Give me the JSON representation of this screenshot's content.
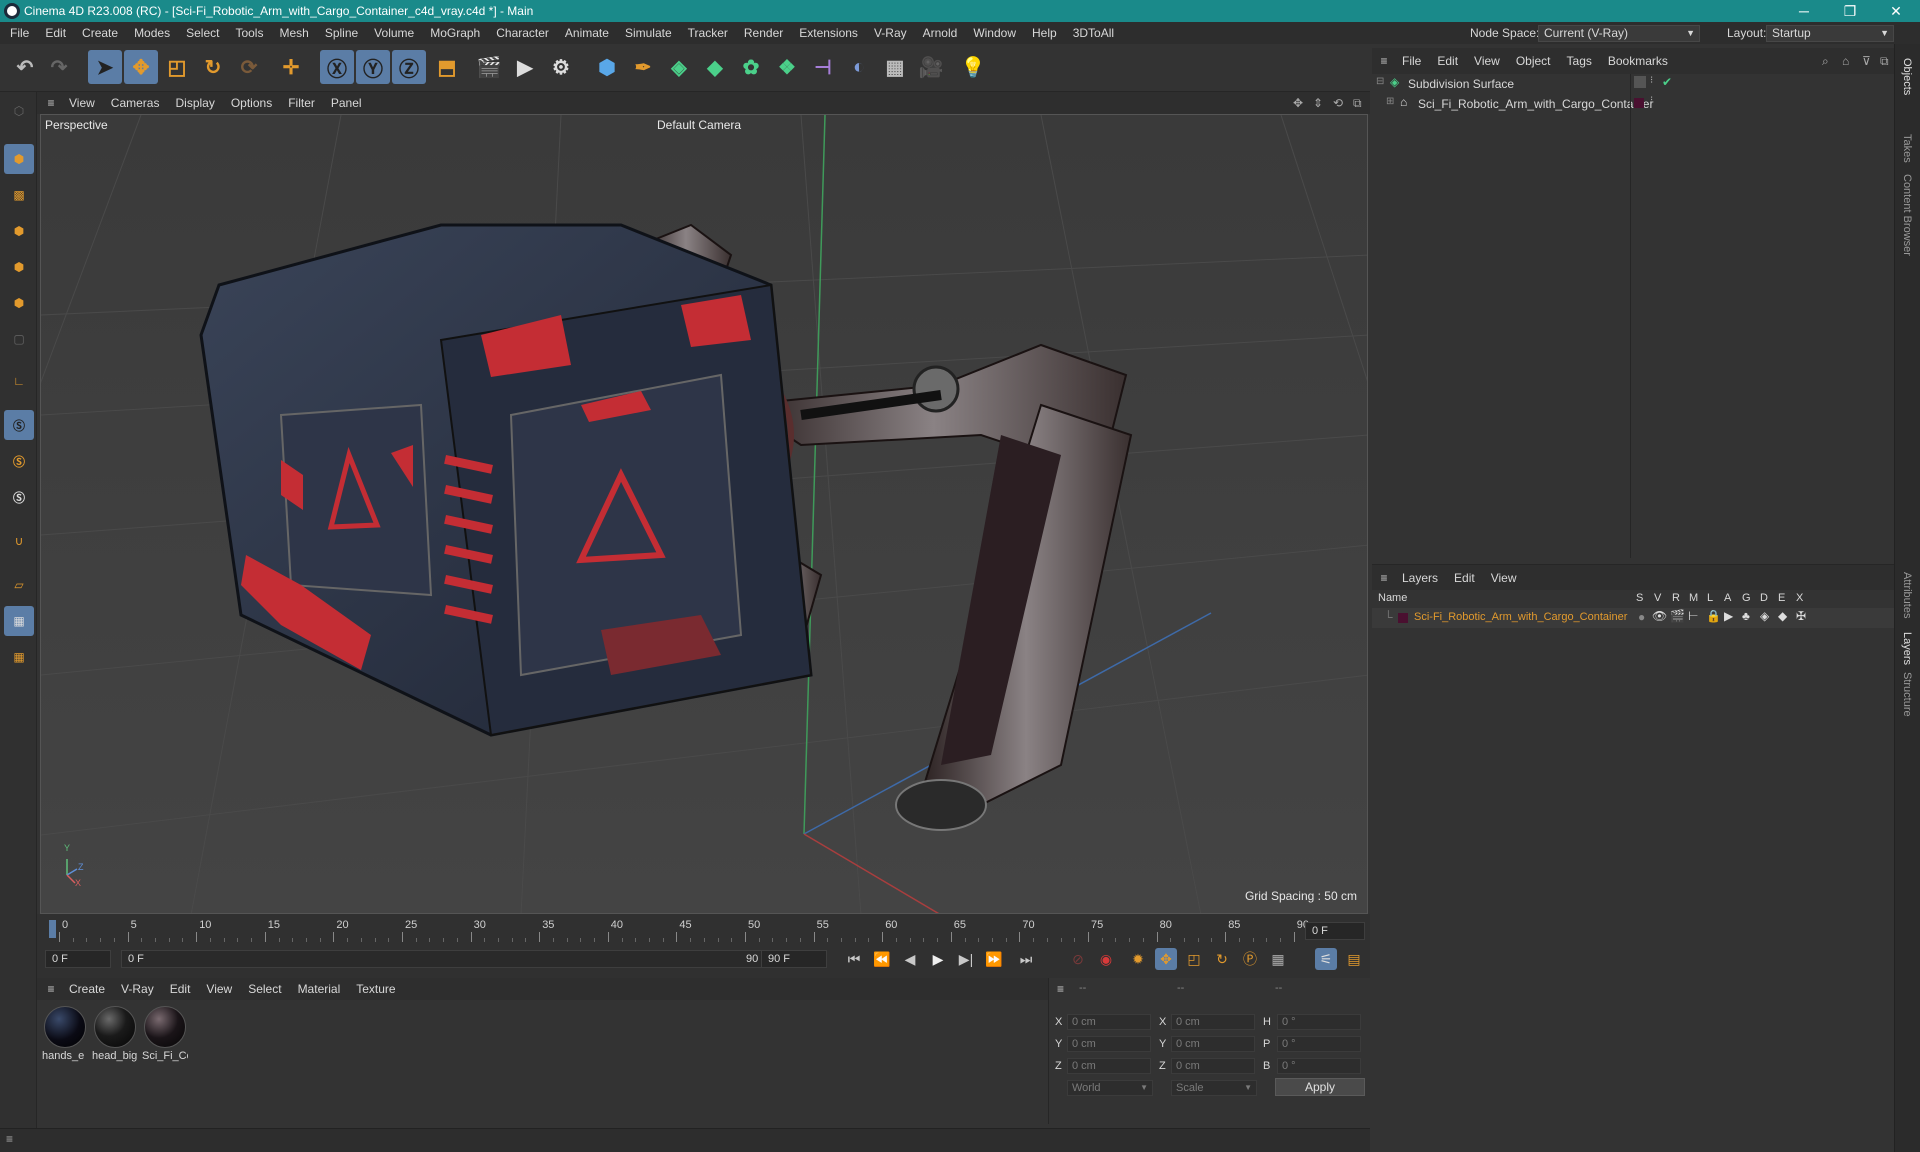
{
  "window": {
    "title": "Cinema 4D R23.008 (RC) - [Sci-Fi_Robotic_Arm_with_Cargo_Container_c4d_vray.c4d *] - Main",
    "minimize": "─",
    "restore": "❐",
    "close": "✕"
  },
  "menubar": {
    "items": [
      "File",
      "Edit",
      "Create",
      "Modes",
      "Select",
      "Tools",
      "Mesh",
      "Spline",
      "Volume",
      "MoGraph",
      "Character",
      "Animate",
      "Simulate",
      "Tracker",
      "Render",
      "Extensions",
      "V-Ray",
      "Arnold",
      "Window",
      "Help",
      "3DToAll"
    ],
    "node_space_label": "Node Space:",
    "node_space_value": "Current (V-Ray)",
    "layout_label": "Layout:",
    "layout_value": "Startup"
  },
  "viewport": {
    "menu": [
      "View",
      "Cameras",
      "Display",
      "Options",
      "Filter",
      "Panel"
    ],
    "name": "Perspective",
    "camera": "Default Camera",
    "grid_spacing": "Grid Spacing : 50 cm",
    "axis_labels": {
      "y": "Y",
      "z": "Z",
      "x": "X"
    }
  },
  "timeline": {
    "ticks": [
      "0",
      "5",
      "10",
      "15",
      "20",
      "25",
      "30",
      "35",
      "40",
      "45",
      "50",
      "55",
      "60",
      "65",
      "70",
      "75",
      "80",
      "85",
      "90"
    ],
    "current_frame": "0 F",
    "start_field": "0 F",
    "range_start": "0 F",
    "range_end": "90 F",
    "end_field": "90 F"
  },
  "materials": {
    "menu": [
      "Create",
      "V-Ray",
      "Edit",
      "View",
      "Select",
      "Material",
      "Texture"
    ],
    "items": [
      "hands_e",
      "head_big",
      "Sci_Fi_Cc"
    ]
  },
  "coordinates": {
    "header": [
      "--",
      "--",
      "--"
    ],
    "rows": [
      {
        "axis": "X",
        "pos": "0 cm",
        "axis2": "X",
        "size": "0 cm",
        "axis3": "H",
        "rot": "0 °"
      },
      {
        "axis": "Y",
        "pos": "0 cm",
        "axis2": "Y",
        "size": "0 cm",
        "axis3": "P",
        "rot": "0 °"
      },
      {
        "axis": "Z",
        "pos": "0 cm",
        "axis2": "Z",
        "size": "0 cm",
        "axis3": "B",
        "rot": "0 °"
      }
    ],
    "mode": "World",
    "type": "Scale",
    "apply": "Apply"
  },
  "objects": {
    "menu": [
      "File",
      "Edit",
      "View",
      "Object",
      "Tags",
      "Bookmarks"
    ],
    "tree": [
      {
        "name": "Subdivision Surface",
        "icon": "subdivision-icon"
      },
      {
        "name": "Sci_Fi_Robotic_Arm_with_Cargo_Container",
        "icon": "null-object-icon"
      }
    ]
  },
  "layers": {
    "menu": [
      "Layers",
      "Edit",
      "View"
    ],
    "columns": [
      "Name",
      "S",
      "V",
      "R",
      "M",
      "L",
      "A",
      "G",
      "D",
      "E",
      "X"
    ],
    "rows": [
      {
        "name": "Sci-Fi_Robotic_Arm_with_Cargo_Container",
        "color": "#4a1030"
      }
    ]
  },
  "right_tabs": [
    "Objects",
    "Takes",
    "Content Browser",
    "Attributes",
    "Layers",
    "Structure"
  ],
  "colors": {
    "accent": "#1a8a8a",
    "selected_tool": "#5b7da6",
    "layer_name": "#e29a2d",
    "highlight": "#e29a2d"
  }
}
